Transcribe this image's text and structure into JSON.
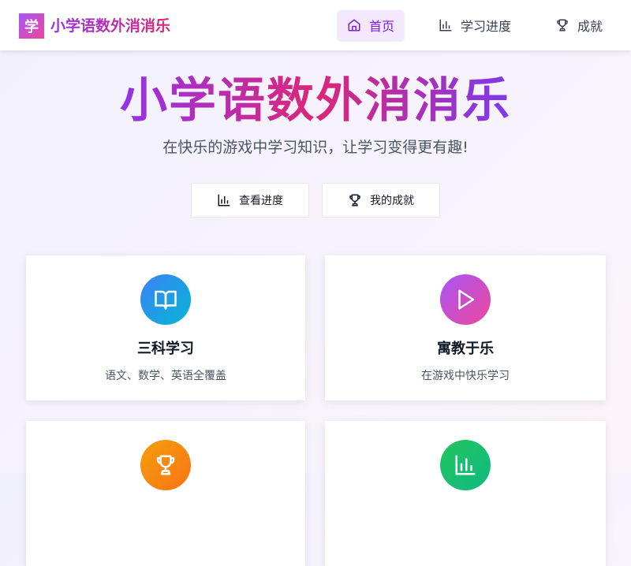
{
  "header": {
    "logo_char": "学",
    "brand": "小学语数外消消乐",
    "nav": {
      "home": "首页",
      "progress": "学习进度",
      "achievements": "成就"
    }
  },
  "hero": {
    "title": "小学语数外消消乐",
    "subtitle": "在快乐的游戏中学习知识，让学习变得更有趣!",
    "buttons": {
      "progress": "查看进度",
      "achievements": "我的成就"
    }
  },
  "features": [
    {
      "title": "三科学习",
      "desc": "语文、数学、英语全覆盖",
      "icon": "book-icon"
    },
    {
      "title": "寓教于乐",
      "desc": "在游戏中快乐学习",
      "icon": "play-icon"
    },
    {
      "title": "",
      "desc": "",
      "icon": "trophy-icon"
    },
    {
      "title": "",
      "desc": "",
      "icon": "bar-chart-icon"
    }
  ],
  "colors": {
    "brand_purple": "#9333ea",
    "brand_pink": "#db2777",
    "nav_active_bg": "#f3e8ff",
    "icon_blue": "#3b82f6",
    "icon_purple": "#a855f7",
    "icon_orange": "#f59e0b",
    "icon_green": "#22c55e"
  }
}
